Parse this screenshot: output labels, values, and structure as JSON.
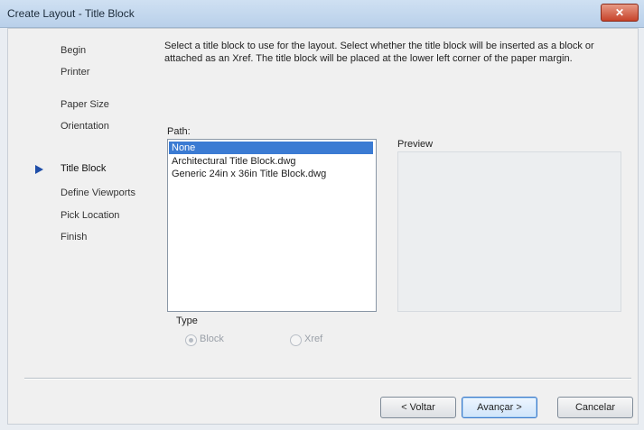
{
  "window": {
    "title": "Create Layout - Title Block",
    "close_glyph": "✕"
  },
  "steps": [
    {
      "label": "Begin"
    },
    {
      "label": "Printer"
    },
    {
      "label": "Paper Size"
    },
    {
      "label": "Orientation"
    },
    {
      "label": "Title Block"
    },
    {
      "label": "Define Viewports"
    },
    {
      "label": "Pick Location"
    },
    {
      "label": "Finish"
    }
  ],
  "current_step": "Title Block",
  "description": "Select a title block to use for the layout. Select whether the title block will be inserted as a block or attached as an Xref. The title block will be placed at the lower left corner of the paper margin.",
  "path_label": "Path:",
  "path_list": {
    "items": [
      "None",
      "Architectural Title Block.dwg",
      "Generic 24in x 36in Title Block.dwg"
    ],
    "selected": "None"
  },
  "preview_label": "Preview",
  "type_group": {
    "label": "Type",
    "options": [
      {
        "label": "Block",
        "checked": true,
        "enabled": false
      },
      {
        "label": "Xref",
        "checked": false,
        "enabled": false
      }
    ]
  },
  "buttons": {
    "back": "< Voltar",
    "next": "Avançar >",
    "cancel": "Cancelar"
  },
  "colors": {
    "selection": "#3b7bd3",
    "current_step_arrow": "#1f4ea8"
  }
}
